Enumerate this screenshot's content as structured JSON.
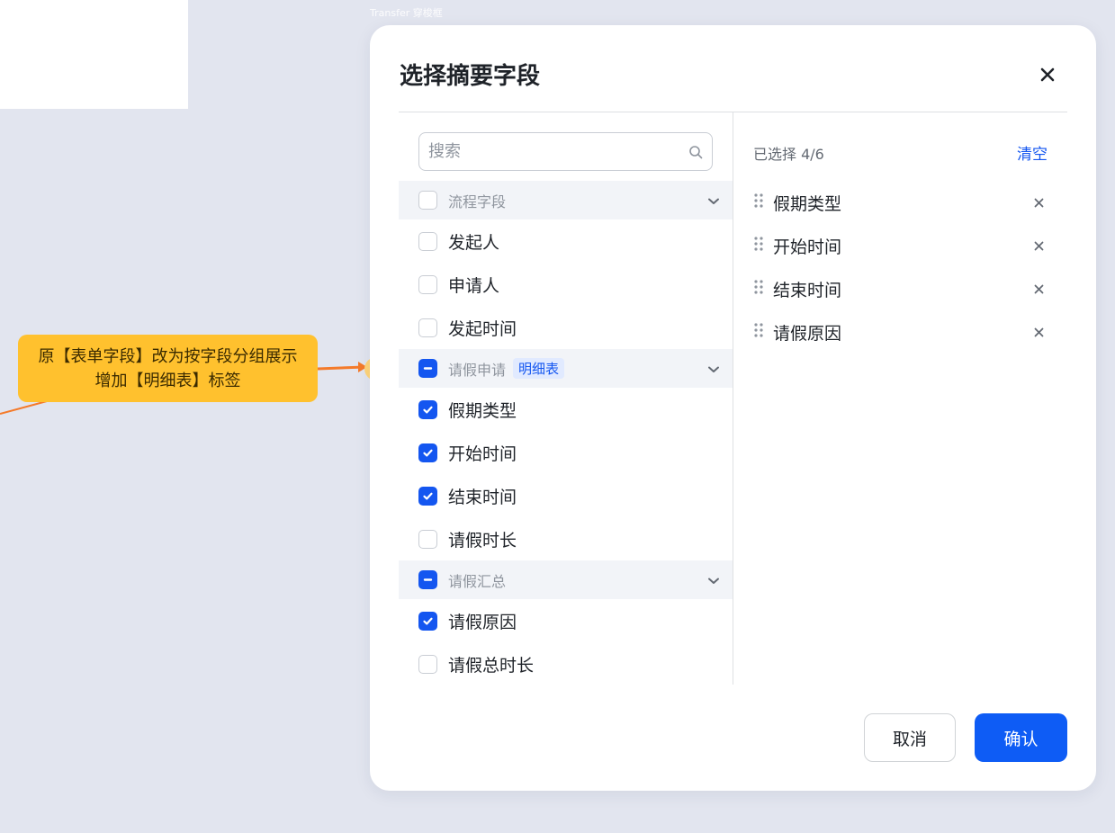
{
  "canvas": {
    "frame_label": "Transfer 穿梭框"
  },
  "annotation": {
    "line1": "原【表单字段】改为按字段分组展示",
    "line2": "增加【明细表】标签",
    "color": "#ffc12e",
    "arrow_color": "#f47a2a"
  },
  "modal": {
    "title": "选择摘要字段",
    "search_placeholder": "搜索",
    "groups": [
      {
        "label": "流程字段",
        "state": "unchecked",
        "tag": "",
        "items": [
          {
            "label": "发起人",
            "checked": false
          },
          {
            "label": "申请人",
            "checked": false
          },
          {
            "label": "发起时间",
            "checked": false
          }
        ]
      },
      {
        "label": "请假申请",
        "state": "partial",
        "tag": "明细表",
        "items": [
          {
            "label": "假期类型",
            "checked": true
          },
          {
            "label": "开始时间",
            "checked": true
          },
          {
            "label": "结束时间",
            "checked": true
          },
          {
            "label": "请假时长",
            "checked": false
          }
        ]
      },
      {
        "label": "请假汇总",
        "state": "partial",
        "tag": "",
        "items": [
          {
            "label": "请假原因",
            "checked": true
          },
          {
            "label": "请假总时长",
            "checked": false
          }
        ]
      }
    ],
    "selected_count": "已选择 4/6",
    "clear_label": "清空",
    "selected": [
      "假期类型",
      "开始时间",
      "结束时间",
      "请假原因"
    ],
    "cancel_label": "取消",
    "confirm_label": "确认",
    "accent": "#1456f0"
  }
}
